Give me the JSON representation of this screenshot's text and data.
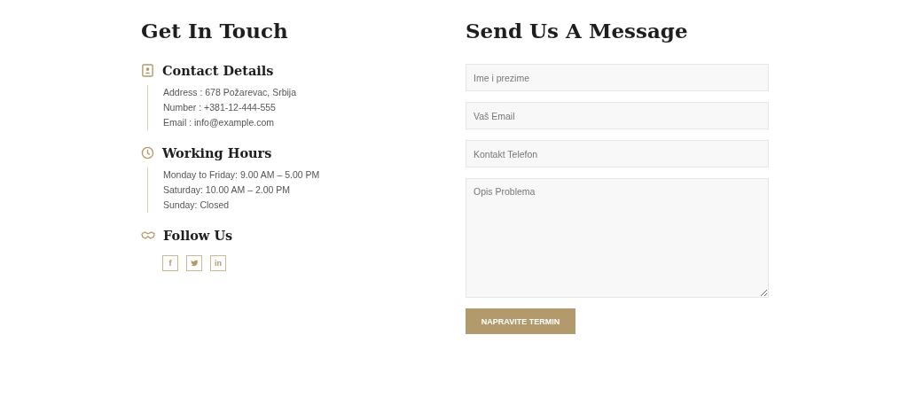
{
  "contact": {
    "title": "Get In Touch",
    "sections": [
      {
        "kind": "contact",
        "heading": "Contact Details",
        "lines": [
          "Address : 678 Požarevac, Srbija",
          "Number : +381-12-444-555",
          "Email : info@example.com"
        ]
      },
      {
        "kind": "hours",
        "heading": "Working Hours",
        "lines": [
          "Monday to Friday: 9.00 AM – 5.00 PM",
          "Saturday: 10.00 AM – 2.00 PM",
          "Sunday: Closed"
        ]
      },
      {
        "kind": "follow",
        "heading": "Follow Us",
        "social": [
          {
            "kind": "facebook",
            "label": "f"
          },
          {
            "kind": "twitter"
          },
          {
            "kind": "linkedin",
            "label": "in"
          }
        ]
      }
    ]
  },
  "form": {
    "title": "Send Us A Message",
    "fields": [
      {
        "kind": "input",
        "placeholder": "Ime i prezime"
      },
      {
        "kind": "input",
        "placeholder": "Vaš Email"
      },
      {
        "kind": "input",
        "placeholder": "Kontakt Telefon"
      },
      {
        "kind": "textarea",
        "placeholder": "Opis Problema"
      }
    ],
    "button": "NAPRAVITE TERMIN"
  }
}
